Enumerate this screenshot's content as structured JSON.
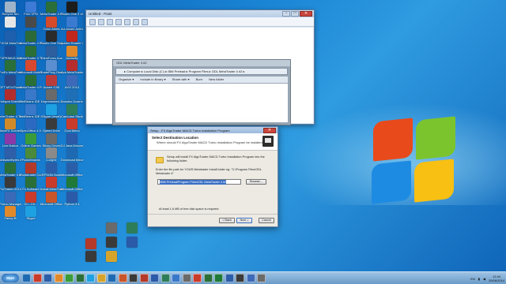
{
  "desktop": {
    "icons": [
      {
        "label": "Recycle Bin",
        "color": "#9fb4c8"
      },
      {
        "label": "Free VPN",
        "color": "#3d7bd6"
      },
      {
        "label": "MetaTrader 4 Pepperstone",
        "color": "#2a6e3a"
      },
      {
        "label": "Studio One 2 x64",
        "color": "#1c1c1c"
      },
      {
        "label": "",
        "color": "#e6e6e6"
      },
      {
        "label": "",
        "color": "#4a4a4a"
      },
      {
        "label": "Orion Alerts",
        "color": "#d54a2a"
      },
      {
        "label": "Ad-Aware Antivirus",
        "color": "#3a7bd0"
      },
      {
        "label": "FXCM MetaTrader 4",
        "color": "#1e5fae"
      },
      {
        "label": "MetaTrader 4 FinFX",
        "color": "#2d6a3a"
      },
      {
        "label": "Studio One Stop",
        "color": "#2b2b2b"
      },
      {
        "label": "Adobe Reader XI",
        "color": "#c1271d"
      },
      {
        "label": "FXPRIMUS MetaTrader 4",
        "color": "#1b4e9a"
      },
      {
        "label": "MetaTrader 4 Terminal",
        "color": "#2a6e3a"
      },
      {
        "label": "ThinkForex Australia Pt...",
        "color": "#2d5e9e"
      },
      {
        "label": "Audacity",
        "color": "#e0892b"
      },
      {
        "label": "ForEx MetaTrader 4",
        "color": "#2a6e3a"
      },
      {
        "label": "Microsoft Mobile Browser",
        "color": "#d6492f"
      },
      {
        "label": "TradeProg Oscillator 2",
        "color": "#5a8fd1"
      },
      {
        "label": "Ava MetaTrader 4",
        "color": "#b52d2d"
      },
      {
        "label": "GFT MT4 Powered by BT",
        "color": "#2a4a8a"
      },
      {
        "label": "MetaTrader 4 Fortress",
        "color": "#2a6e3a"
      },
      {
        "label": "Adobe CS6",
        "color": "#b83c3c"
      },
      {
        "label": "AVG 2014",
        "color": "#3d6ab8"
      },
      {
        "label": "Hotspot Shield Launch",
        "color": "#b32d2d"
      },
      {
        "label": "NetBeans IDE 7.3.1",
        "color": "#3a78c9"
      },
      {
        "label": "Unpresented...",
        "color": "#6a6a6a"
      },
      {
        "label": "Bossfox Download",
        "color": "#1f6fb7"
      },
      {
        "label": "InterTrader 4 Terminal",
        "color": "#2a6e3a"
      },
      {
        "label": "NetBeans IDE 8.0",
        "color": "#3a78c9"
      },
      {
        "label": "Skype (reset)",
        "color": "#1ea1e2"
      },
      {
        "label": "CamLase Studio 8",
        "color": "#2e7d5a"
      },
      {
        "label": "JavaFX Scene Builder 2.0",
        "color": "#d08a2a"
      },
      {
        "label": "OpenOffice 4.0.1",
        "color": "#2c6ac2"
      },
      {
        "label": "Speed Drive",
        "color": "#3b3b3b"
      },
      {
        "label": "Cool Menu",
        "color": "#c93b2b"
      },
      {
        "label": "Live Nation",
        "color": "#8a3aa8"
      },
      {
        "label": "Online Games",
        "color": "#3a9b3a"
      },
      {
        "label": "Sticky Drives",
        "color": "#6a6a6a"
      },
      {
        "label": "DJ Java Decompiler",
        "color": "#2a5aa8"
      },
      {
        "label": "MalwareBytes Anti-Malware",
        "color": "#2e5fa8"
      },
      {
        "label": "Pocketmania",
        "color": "#4a8a3a"
      },
      {
        "label": "Lunghe",
        "color": "#8a8a8a"
      },
      {
        "label": "Download Manager",
        "color": "#1e6ab2"
      },
      {
        "label": "MetaTrader 4 AlpariUK",
        "color": "#2a6e3a"
      },
      {
        "label": "Punkbuster Connection",
        "color": "#b33a2a"
      },
      {
        "label": "EPSON Scan",
        "color": "#2b5ea8"
      },
      {
        "label": "Microsoft Office Word",
        "color": "#2b5ea8"
      },
      {
        "label": "ProTrader 2014",
        "color": "#3a3a3a"
      },
      {
        "label": "Fx Software",
        "color": "#2a6e3a"
      },
      {
        "label": "Install MetaTrader 4 BA-Dr.QA",
        "color": "#c93b2b"
      },
      {
        "label": "Microsoft Office Excel",
        "color": "#1f7a3a"
      },
      {
        "label": "Proton Manager",
        "color": "#3a6ab8"
      },
      {
        "label": "Ch...Ch...",
        "color": "#c93b2b"
      },
      {
        "label": "Microsoft Office PowerPoint",
        "color": "#c9552b"
      },
      {
        "label": "Python 3.4",
        "color": "#2a5aa8"
      },
      {
        "label": "Fancy ffi",
        "color": "#e0892b"
      },
      {
        "label": "Skype",
        "color": "#1ea1e2"
      },
      {
        "label": "",
        "color": "#3a3a3a"
      },
      {
        "label": "",
        "color": "#2a5aa8"
      },
      {
        "label": "",
        "color": "#d6a42b"
      },
      {
        "label": "",
        "color": "#3a3a3a"
      },
      {
        "label": "",
        "color": "#6a6a6a"
      },
      {
        "label": "",
        "color": "#2e7d5a"
      },
      {
        "label": "",
        "color": "#b33a2a"
      }
    ]
  },
  "paint": {
    "title": "Untitled - Paint",
    "embedded_title": "ODL MetaTrader 4 #2",
    "address": "▸ Computer ▸ Local Disk (C:) ▸ IBM Prelead ▸ Program Files ▸ ODL MetaTrader 4 #2 ▸",
    "commands": [
      "Organize ▾",
      "Include in library ▾",
      "Share with ▾",
      "Burn",
      "New folder"
    ]
  },
  "installer": {
    "title": "Setup - FX AlgoTrader MACD Turbo Installation Program",
    "header": "Select Destination Location",
    "subheader": "Where should FX AlgoTrader MACD Turbo Installation Program be installed?",
    "info": "Setup will install FX AlgoTrader MACD Turbo Installation Program into the following folder.",
    "prompt": "Enter the file path for YOUR Metatrader install folder eg: \"C:\\Program Files\\ODL Metatrader 4\"",
    "path_value": "\\IBM Prelead\\Program Files\\ODL MetaTrader 4 #2",
    "browse_label": "Browse...",
    "space_note": "At least 1.6 MB of free disk space is required.",
    "back_label": "< Back",
    "next_label": "Next >",
    "cancel_label": "Cancel"
  },
  "taskbar": {
    "start_label": "Start",
    "items": [
      "#1e6ab2",
      "#c93b2b",
      "#2b5ea8",
      "#e0892b",
      "#3a9b3a",
      "#2a6e3a",
      "#1ea1e2",
      "#d6a42b",
      "#1e6ab2",
      "#c9552b",
      "#3a3a3a",
      "#b33a2a",
      "#2a5aa8",
      "#2e7d5a",
      "#3a78c9",
      "#6a6a6a",
      "#c93b2b",
      "#2a6e3a",
      "#1f7a3a",
      "#2b5ea8",
      "#3a3a3a",
      "#3d6ab8",
      "#6a6a6a"
    ],
    "language": "EN",
    "time": "12:40",
    "date": "20/06/2014"
  }
}
